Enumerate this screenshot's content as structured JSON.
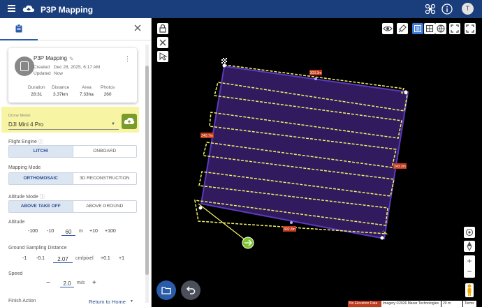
{
  "app": {
    "title": "P3P Mapping",
    "avatar_letter": "T"
  },
  "project": {
    "name": "P3P Mapping",
    "created_label": "Created",
    "created_value": "Dec 28, 2025, 6:17 AM",
    "updated_label": "Updated",
    "updated_value": "Now",
    "stats": [
      {
        "label": "Duration",
        "value": "28:31"
      },
      {
        "label": "Distance",
        "value": "3.37km"
      },
      {
        "label": "Area",
        "value": "7.33ha"
      },
      {
        "label": "Photos",
        "value": "260"
      }
    ]
  },
  "drone_model": {
    "label": "Drone Model",
    "value": "DJI Mini 4 Pro"
  },
  "flight_engine": {
    "label": "Flight Engine",
    "options": [
      "LITCHI",
      "ONBOARD"
    ],
    "selected": "LITCHI"
  },
  "mapping_mode": {
    "label": "Mapping Mode",
    "options": [
      "ORTHOMOSAIC",
      "3D RECONSTRUCTION"
    ],
    "selected": "ORTHOMOSAIC"
  },
  "altitude_mode": {
    "label": "Altitude Mode",
    "options": [
      "ABOVE TAKE OFF",
      "ABOVE GROUND"
    ],
    "selected": "ABOVE TAKE OFF"
  },
  "altitude": {
    "label": "Altitude",
    "dec": [
      "-100",
      "-10"
    ],
    "value": "60",
    "unit": "m",
    "inc": [
      "+10",
      "+100"
    ]
  },
  "gsd": {
    "label": "Ground Sampling Distance",
    "dec": [
      "-1",
      "-0.1"
    ],
    "value": "2.07",
    "unit": "cm/pixel",
    "inc": [
      "+0.1",
      "+1"
    ]
  },
  "speed": {
    "label": "Speed",
    "minus": "−",
    "value": "2.0",
    "unit": "m/s",
    "plus": "+"
  },
  "finish_action": {
    "label": "Finish Action",
    "value": "Return to Home"
  },
  "map": {
    "dimension_labels": [
      "303.3m",
      "240.7m",
      "243.3m",
      "302.3m"
    ],
    "footer": [
      "No Elevation Data",
      "Imagery ©2026 Maxar Technologies",
      "20 m",
      "Terms"
    ]
  },
  "colors": {
    "topbar": "#1a3d7c",
    "accent": "#2a5caa",
    "highlight": "#f7f5a3",
    "polygon": "#3a1f6e",
    "path": "#f2f266",
    "home": "#7cc42a"
  }
}
